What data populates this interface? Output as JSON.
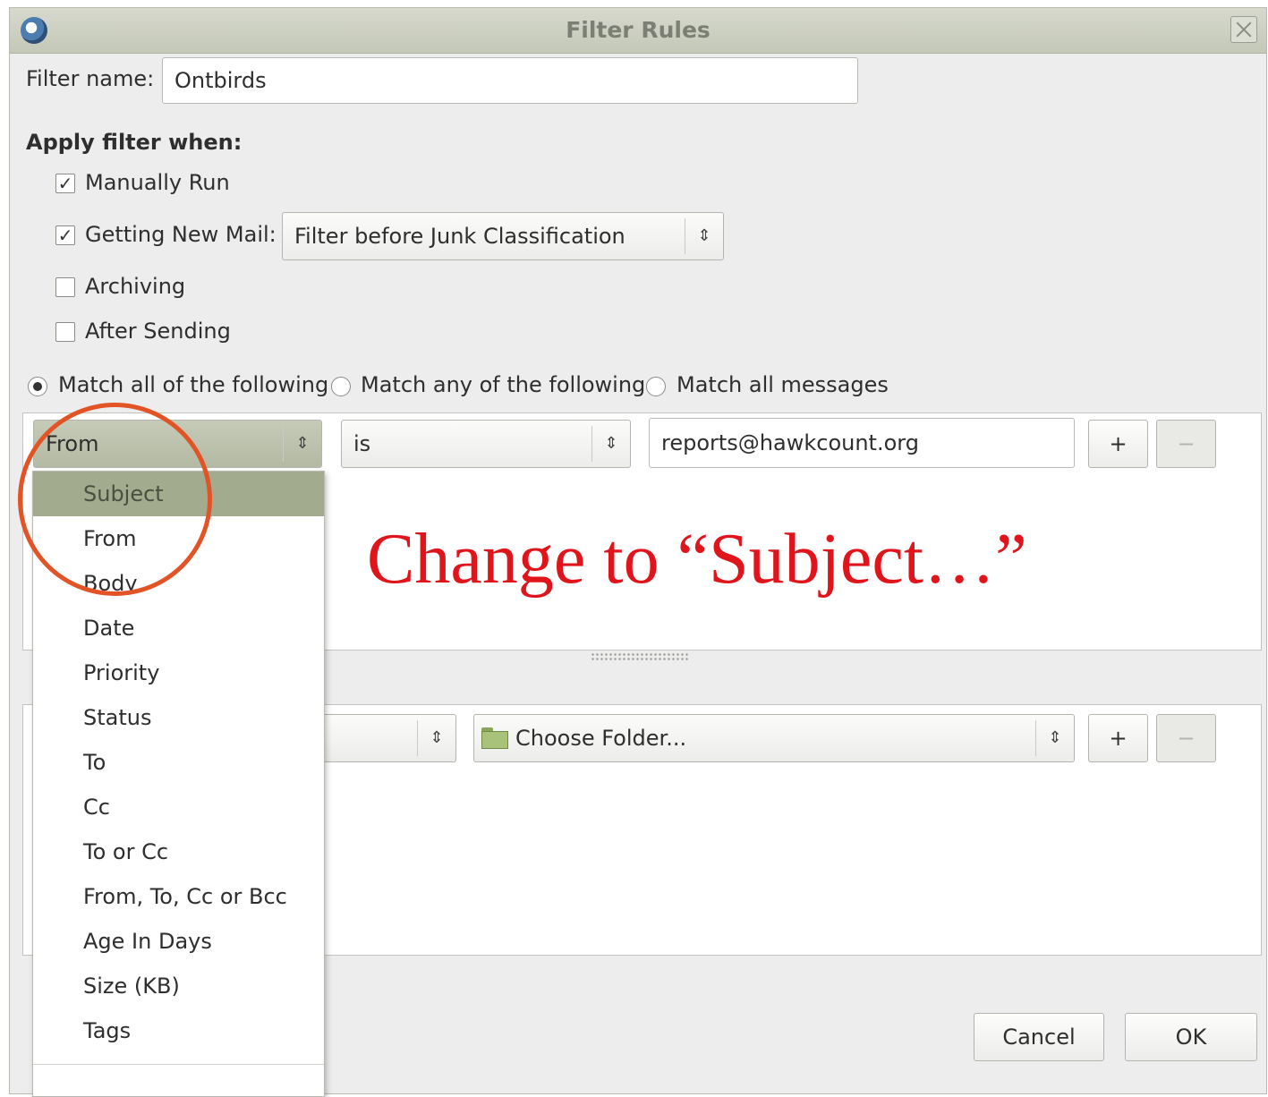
{
  "window": {
    "title": "Filter Rules"
  },
  "filter_name": {
    "label": "Filter name:",
    "value": "Ontbirds"
  },
  "apply_when": {
    "heading": "Apply filter when:",
    "manually_run": {
      "label": "Manually Run",
      "checked": true
    },
    "getting_new_mail": {
      "label": "Getting New Mail:",
      "checked": true,
      "timing": "Filter before Junk Classification"
    },
    "archiving": {
      "label": "Archiving",
      "checked": false
    },
    "after_sending": {
      "label": "After Sending",
      "checked": false
    }
  },
  "match": {
    "options": [
      "Match all of the following",
      "Match any of the following",
      "Match all messages"
    ],
    "selected": "Match all of the following"
  },
  "rule": {
    "field": "From",
    "operator": "is",
    "value": "reports@hawkcount.org",
    "add_label": "+",
    "remove_label": "−"
  },
  "field_menu": {
    "items": [
      "Subject",
      "From",
      "Body",
      "Date",
      "Priority",
      "Status",
      "To",
      "Cc",
      "To or Cc",
      "From, To, Cc or Bcc",
      "Age In Days",
      "Size (KB)",
      "Tags"
    ],
    "selected": "Subject"
  },
  "action": {
    "folder": "Choose Folder...",
    "add_label": "+",
    "remove_label": "−"
  },
  "buttons": {
    "cancel": "Cancel",
    "ok": "OK"
  },
  "annotation": {
    "text": "Change to “Subject…”",
    "color": "#e0141b",
    "circle_color": "#e25426"
  },
  "colors": {
    "menu_highlight": "#a2ab8d",
    "titlebar": "#c4c8b8"
  }
}
